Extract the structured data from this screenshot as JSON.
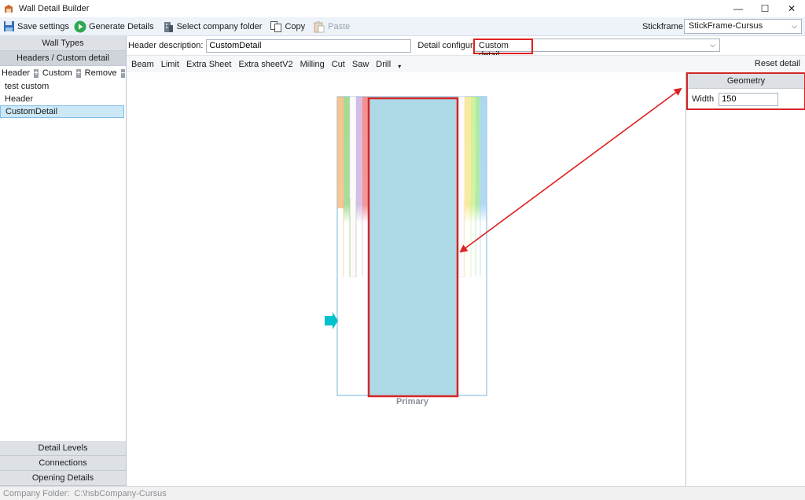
{
  "window": {
    "title": "Wall Detail Builder",
    "controls": [
      "—",
      "☐",
      "✕"
    ]
  },
  "toolbar": {
    "save_settings": "Save settings",
    "generate_details": "Generate Details",
    "select_company_folder": "Select company folder",
    "copy": "Copy",
    "paste": "Paste",
    "stickframe_label": "Stickframe:",
    "stickframe_value": "StickFrame-Cursus"
  },
  "sidebar": {
    "wall_types": "Wall Types",
    "headers_custom": "Headers / Custom detail",
    "list_toolbar": {
      "header": "Header",
      "custom": "Custom",
      "remove": "Remove"
    },
    "items": [
      {
        "label": "test custom",
        "selected": false
      },
      {
        "label": "Header",
        "selected": false
      },
      {
        "label": "CustomDetail",
        "selected": true
      }
    ],
    "detail_levels": "Detail Levels",
    "connections": "Connections",
    "opening_details": "Opening Details"
  },
  "header": {
    "description_label": "Header description:",
    "description_value": "CustomDetail",
    "config_label": "Detail configuration:",
    "config_value": "Custom detail"
  },
  "menu": {
    "items": [
      "Beam",
      "Limit",
      "Extra Sheet",
      "Extra sheetV2",
      "Milling",
      "Cut",
      "Saw",
      "Drill"
    ],
    "reset_detail": "Reset detail"
  },
  "canvas": {
    "primary_label": "Primary"
  },
  "geometry": {
    "title": "Geometry",
    "width_label": "Width",
    "width_value": "150"
  },
  "statusbar": {
    "label": "Company Folder:",
    "path": "C:\\hsbCompany-Cursus"
  },
  "colors": {
    "highlight": "#e02020",
    "primary_fill": "#add8e6",
    "accent": "#00bcd4"
  }
}
